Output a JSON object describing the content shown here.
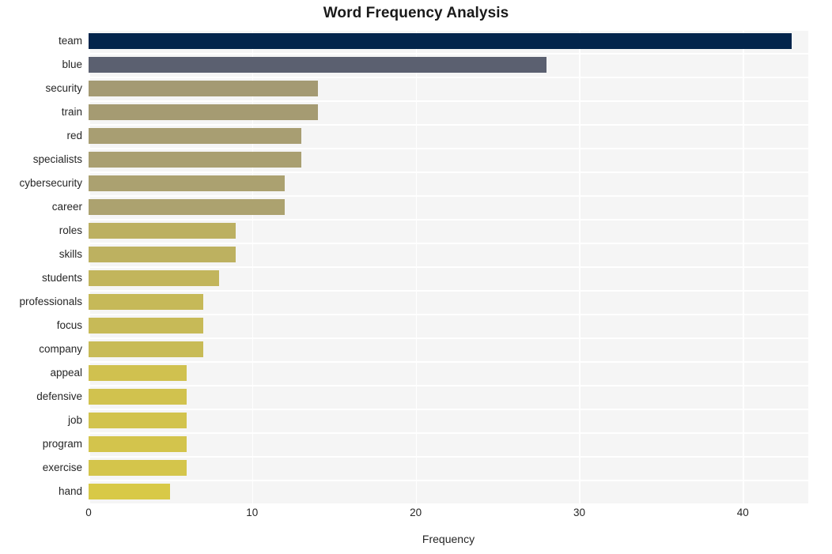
{
  "chart_data": {
    "type": "bar",
    "orientation": "horizontal",
    "title": "Word Frequency Analysis",
    "xlabel": "Frequency",
    "ylabel": "",
    "xlim": [
      0,
      44
    ],
    "ylim": null,
    "grid": true,
    "legend": null,
    "xticks": [
      "0",
      "10",
      "20",
      "30",
      "40"
    ],
    "xtick_values": [
      0,
      10,
      20,
      30,
      40
    ],
    "categories": [
      "team",
      "blue",
      "security",
      "train",
      "red",
      "specialists",
      "cybersecurity",
      "career",
      "roles",
      "skills",
      "students",
      "professionals",
      "focus",
      "company",
      "appeal",
      "defensive",
      "job",
      "program",
      "exercise",
      "hand"
    ],
    "values": [
      43,
      28,
      14,
      14,
      13,
      13,
      12,
      12,
      9,
      9,
      8,
      7,
      7,
      7,
      6,
      6,
      6,
      6,
      6,
      5
    ],
    "bar_colors": [
      "#03254c",
      "#5b6070",
      "#a49a73",
      "#a59b72",
      "#a89e72",
      "#a99f71",
      "#ab a170",
      "#aca26f",
      "#bcb061",
      "#bdb160",
      "#c2b55c",
      "#c6b958",
      "#c7ba57",
      "#c8bb56",
      "#d0c14f",
      "#d1c24e",
      "#d2c34d",
      "#d3c44c",
      "#d4c54b",
      "#d8c947"
    ]
  },
  "colors": {
    "plot_background": "#f5f5f5",
    "figure_background": "#ffffff",
    "gridline": "#ffffff",
    "text": "#262626",
    "title": "#1a1a1a"
  }
}
